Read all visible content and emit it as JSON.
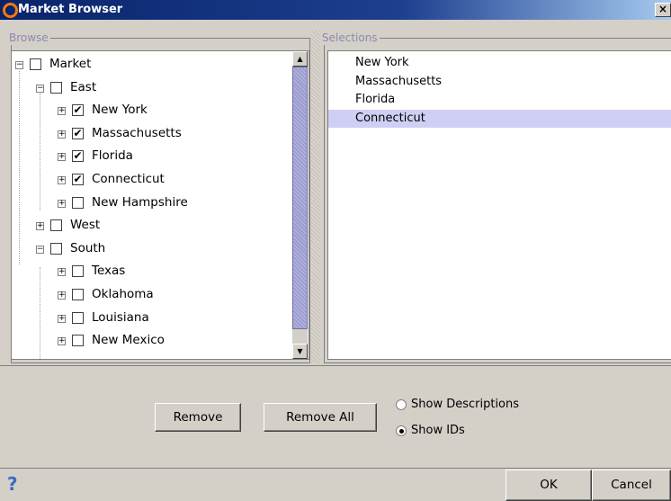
{
  "window": {
    "title": "Market Browser",
    "close_glyph": "×"
  },
  "browse": {
    "legend": "Browse",
    "tree": [
      {
        "label": "Market",
        "level": 0,
        "expander": "−",
        "checked": false
      },
      {
        "label": "East",
        "level": 1,
        "expander": "−",
        "checked": false
      },
      {
        "label": "New York",
        "level": 2,
        "expander": "+",
        "checked": true
      },
      {
        "label": "Massachusetts",
        "level": 2,
        "expander": "+",
        "checked": true
      },
      {
        "label": "Florida",
        "level": 2,
        "expander": "+",
        "checked": true
      },
      {
        "label": "Connecticut",
        "level": 2,
        "expander": "+",
        "checked": true
      },
      {
        "label": "New Hampshire",
        "level": 2,
        "expander": "+",
        "checked": false
      },
      {
        "label": "West",
        "level": 1,
        "expander": "+",
        "checked": false
      },
      {
        "label": "South",
        "level": 1,
        "expander": "−",
        "checked": false
      },
      {
        "label": "Texas",
        "level": 2,
        "expander": "+",
        "checked": false
      },
      {
        "label": "Oklahoma",
        "level": 2,
        "expander": "+",
        "checked": false
      },
      {
        "label": "Louisiana",
        "level": 2,
        "expander": "+",
        "checked": false
      },
      {
        "label": "New Mexico",
        "level": 2,
        "expander": "+",
        "checked": false
      }
    ],
    "scroll_up": "▲",
    "scroll_down": "▼",
    "check_mark": "✔"
  },
  "selections": {
    "legend": "Selections",
    "items": [
      "New York",
      "Massachusetts",
      "Florida",
      "Connecticut"
    ],
    "selected_index": 3
  },
  "actions": {
    "remove_label": "Remove",
    "remove_all_label": "Remove All"
  },
  "display_options": {
    "show_descriptions_label": "Show Descriptions",
    "show_ids_label": "Show IDs",
    "selected": "show_ids"
  },
  "footer": {
    "help_glyph": "?",
    "ok_label": "OK",
    "cancel_label": "Cancel"
  },
  "colors": {
    "title_bar": "#0a246a",
    "selection_highlight": "#cfcff5",
    "scroll_thumb": "#9c9cd0",
    "app_icon": "#f07a10"
  }
}
